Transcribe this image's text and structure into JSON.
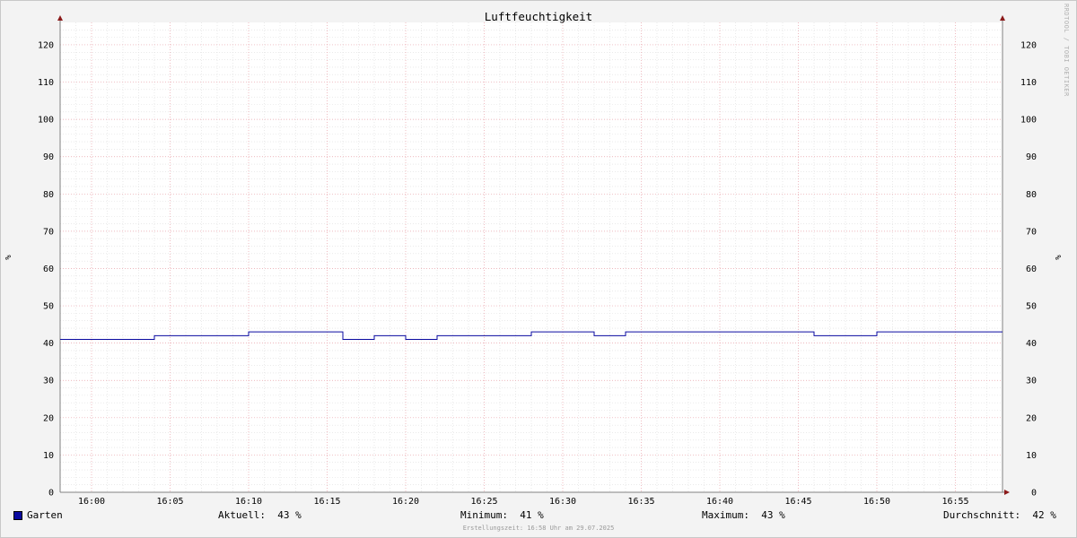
{
  "chart_data": {
    "type": "line",
    "title": "Luftfeuchtigkeit",
    "ylabel": "%",
    "ylabel_right": "%",
    "ylim": [
      0,
      126
    ],
    "yticks": [
      0,
      10,
      20,
      30,
      40,
      50,
      60,
      70,
      80,
      90,
      100,
      110,
      120
    ],
    "xlim": [
      "15:58",
      "16:58"
    ],
    "xticks": [
      "16:00",
      "16:05",
      "16:10",
      "16:15",
      "16:20",
      "16:25",
      "16:30",
      "16:35",
      "16:40",
      "16:45",
      "16:50",
      "16:55"
    ],
    "grid": true,
    "series": [
      {
        "name": "Garten",
        "color": "#0a0aa0",
        "points": [
          [
            "15:58",
            41
          ],
          [
            "16:04",
            42
          ],
          [
            "16:10",
            43
          ],
          [
            "16:16",
            41
          ],
          [
            "16:18",
            42
          ],
          [
            "16:20",
            41
          ],
          [
            "16:22",
            42
          ],
          [
            "16:28",
            43
          ],
          [
            "16:32",
            42
          ],
          [
            "16:34",
            43
          ],
          [
            "16:46",
            42
          ],
          [
            "16:50",
            43
          ],
          [
            "16:58",
            43
          ]
        ]
      }
    ]
  },
  "legend": {
    "series_name": "Garten",
    "current_label": "Aktuell:",
    "current_value": "43 %",
    "min_label": "Minimum:",
    "min_value": "41 %",
    "max_label": "Maximum:",
    "max_value": "43 %",
    "avg_label": "Durchschnitt:",
    "avg_value": "42 %"
  },
  "footer": "Erstellungszeit: 16:58 Uhr am 29.07.2025",
  "watermark": "RRDTOOL / TOBI OETIKER"
}
